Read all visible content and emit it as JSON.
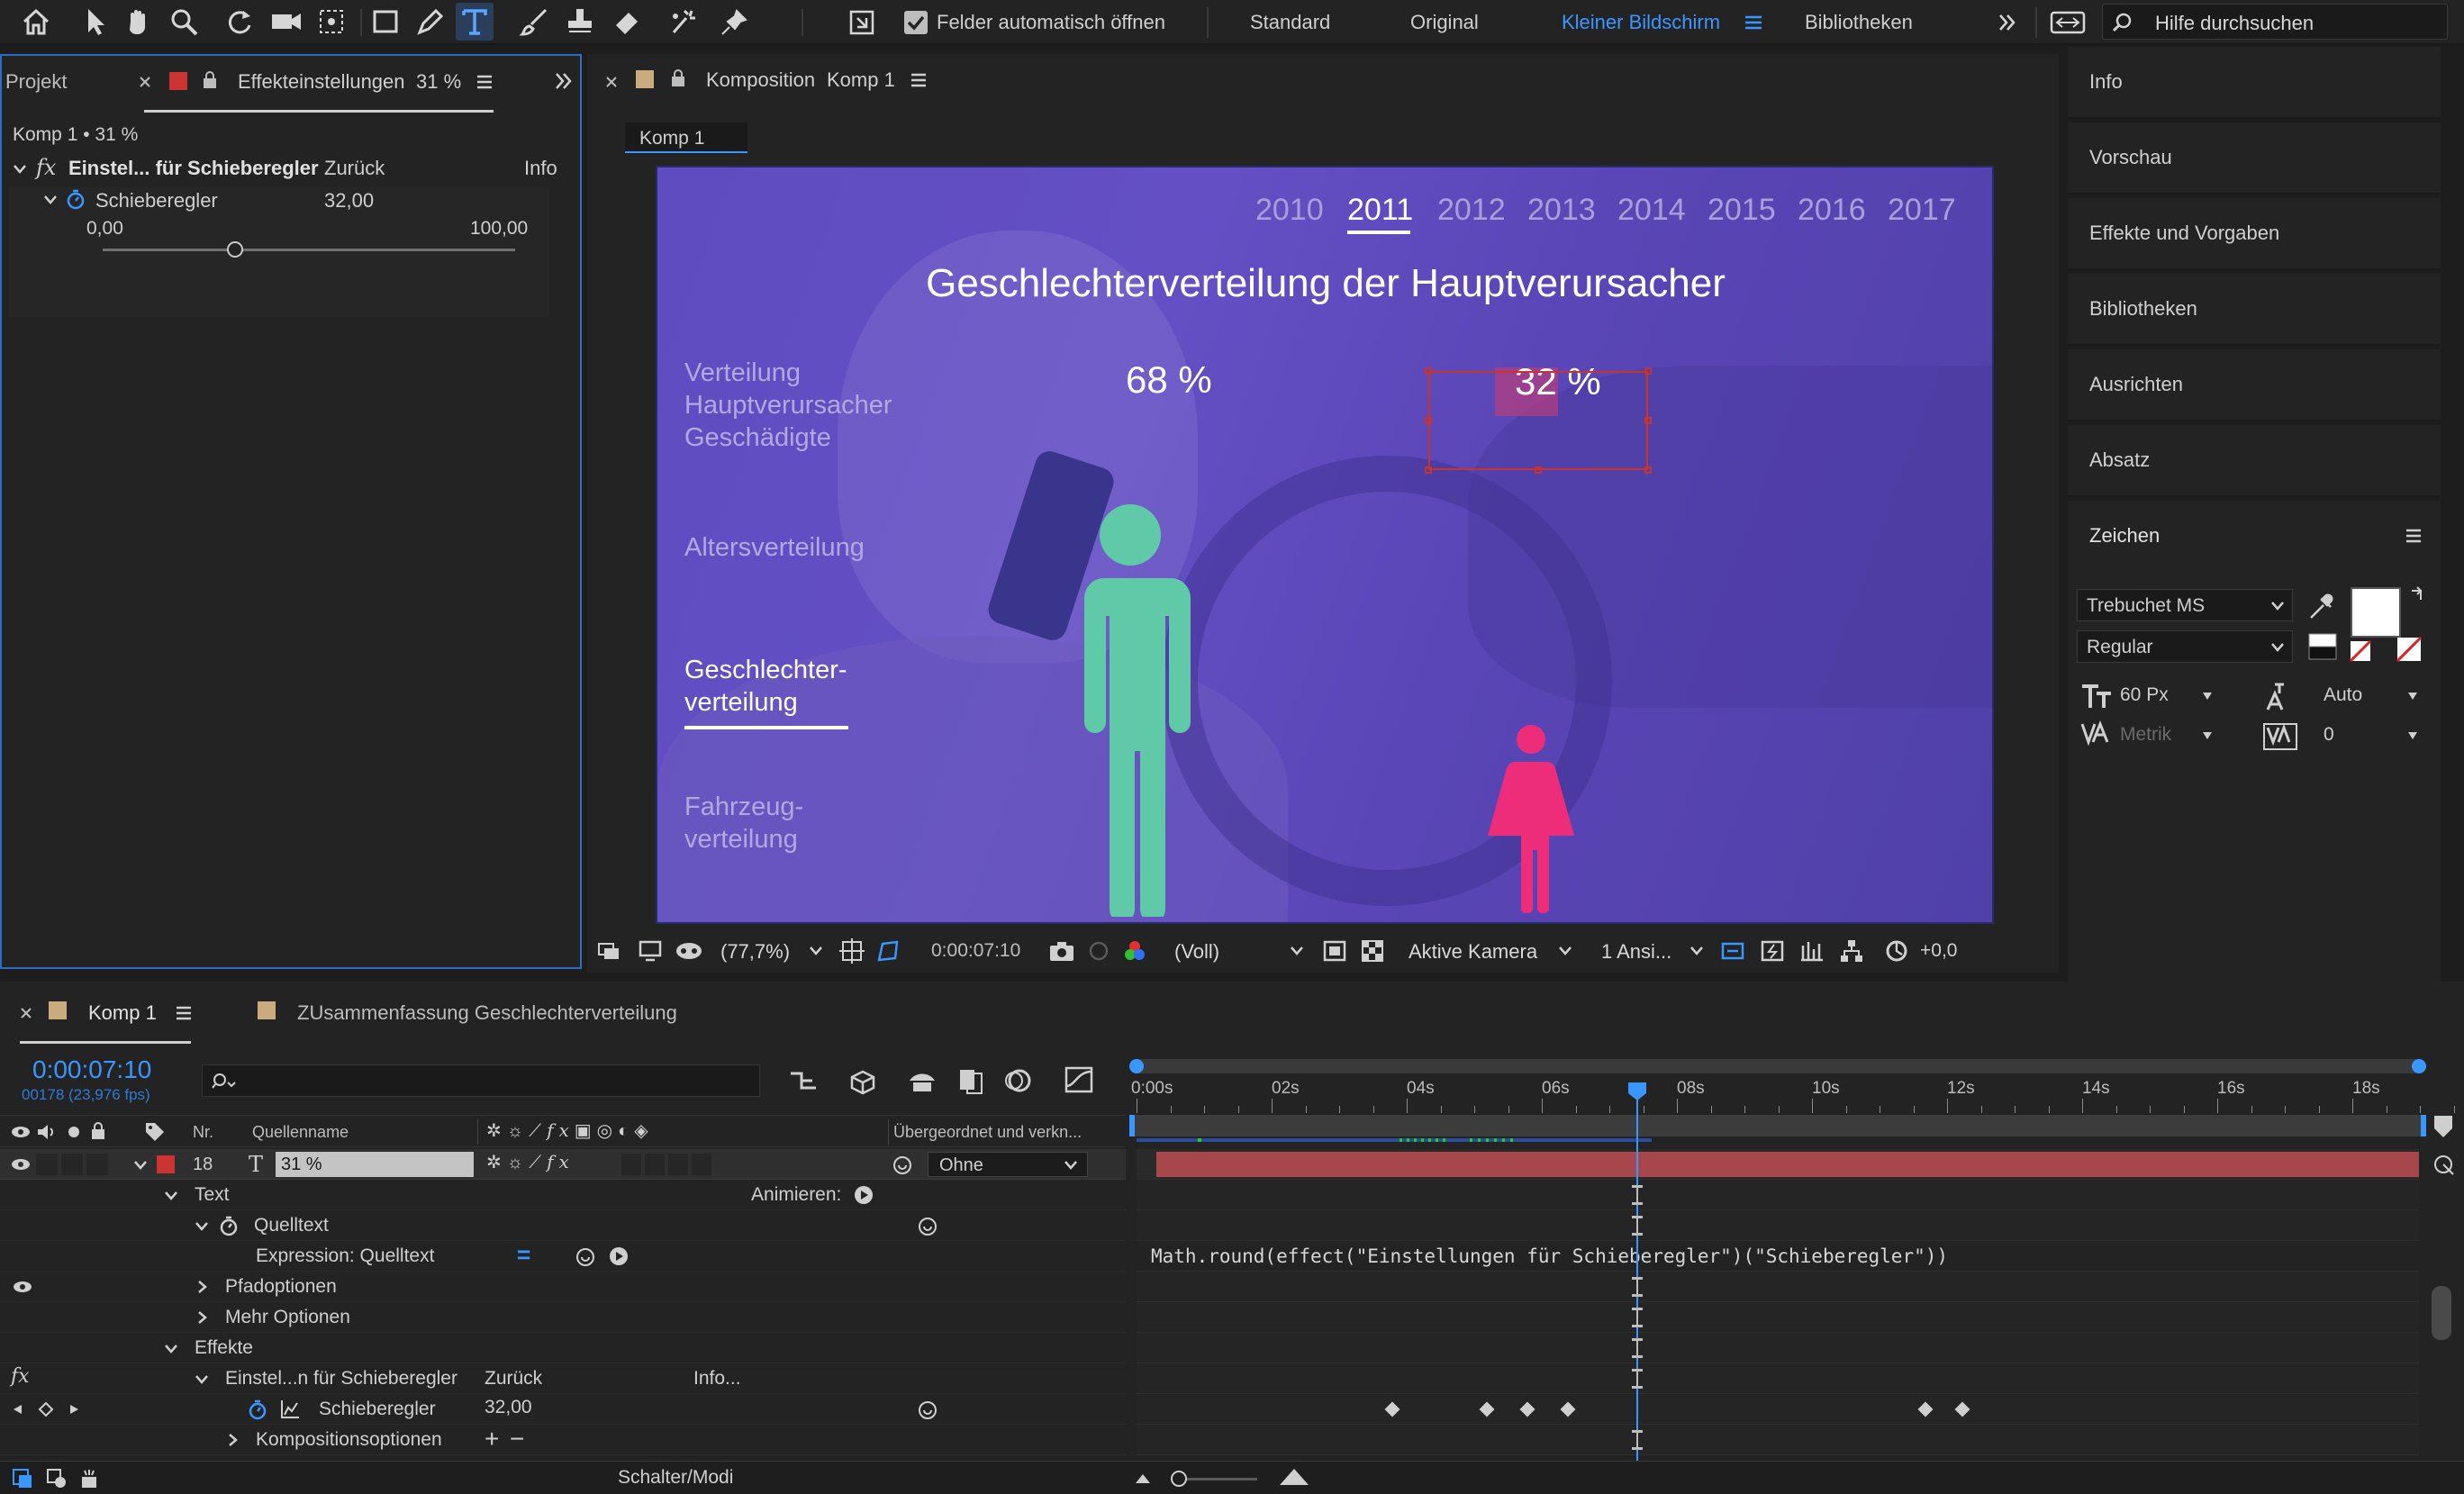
{
  "toolbar": {
    "auto_open_label": "Felder automatisch öffnen",
    "workspaces": [
      "Standard",
      "Original",
      "Kleiner Bildschirm",
      "Bibliotheken"
    ],
    "active_workspace": "Kleiner Bildschirm",
    "search_placeholder": "Hilfe durchsuchen"
  },
  "left_panel": {
    "tab_project": "Projekt",
    "tab_effects_prefix": "Effekteinstellungen",
    "tab_effects_value": "31 %",
    "breadcrumb": "Komp 1 • 31 %",
    "effect_name": "Einstel... für Schieberegler",
    "effect_reset": "Zurück",
    "effect_info": "Info",
    "slider_label": "Schieberegler",
    "slider_value": "32,00",
    "slider_min": "0,00",
    "slider_max": "100,00",
    "slider_fraction": 0.32
  },
  "comp_panel": {
    "tab_prefix": "Komposition",
    "tab_name": "Komp 1",
    "subtab": "Komp 1"
  },
  "viewer": {
    "years": [
      "2010",
      "2011",
      "2012",
      "2013",
      "2014",
      "2015",
      "2016",
      "2017"
    ],
    "active_year": "2011",
    "title": "Geschlechterverteilung der Hauptverursacher",
    "menu": [
      "Verteilung",
      "Hauptverursacher",
      "Geschädigte"
    ],
    "menu_age": "Altersverteilung",
    "menu_gender_1": "Geschlechter-",
    "menu_gender_2": "verteilung",
    "menu_vehicle_1": "Fahrzeug-",
    "menu_vehicle_2": "verteilung",
    "male_pct": "68 %",
    "female_pct": "32 %",
    "colors": {
      "bg": "#5a48b8",
      "male": "#5fc9a8",
      "female": "#ee2d7a"
    }
  },
  "viewer_bar": {
    "zoom": "(77,7%)",
    "timecode": "0:00:07:10",
    "resolution": "(Voll)",
    "camera": "Aktive Kamera",
    "views": "1 Ansi...",
    "exposure": "+0,0"
  },
  "right_panel": {
    "items": [
      "Info",
      "Vorschau",
      "Effekte und Vorgaben",
      "Bibliotheken",
      "Ausrichten",
      "Absatz"
    ],
    "char_title": "Zeichen",
    "font": "Trebuchet MS",
    "style": "Regular",
    "size": "60 Px",
    "leading": "Auto",
    "kerning": "Metrik",
    "tracking": "0"
  },
  "timeline": {
    "tab1": "Komp 1",
    "tab2": "ZUsammenfassung Geschlechterverteilung",
    "timecode": "0:00:07:10",
    "frames": "00178 (23,976 fps)",
    "col_nr": "Nr.",
    "col_source": "Quellenname",
    "col_parent": "Übergeordnet und verkn...",
    "layer_num": "18",
    "layer_name": "31 %",
    "parent_value": "Ohne",
    "rows": {
      "text": "Text",
      "animate": "Animieren:",
      "source_text": "Quelltext",
      "expression": "Expression: Quelltext",
      "path": "Pfadoptionen",
      "more": "Mehr Optionen",
      "effects": "Effekte",
      "effect": "Einstel...n für Schieberegler",
      "reset": "Zurück",
      "info": "Info...",
      "slider": "Schieberegler",
      "slider_val": "32,00",
      "comp_opts": "Kompositionsoptionen"
    },
    "expression_code": "Math.round(effect(\"Einstellungen für Schieberegler\")(\"Schieberegler\"))",
    "ruler": [
      "0:00s",
      "02s",
      "04s",
      "06s",
      "08s",
      "10s",
      "12s",
      "14s",
      "16s",
      "18s"
    ],
    "footer": "Schalter/Modi"
  }
}
